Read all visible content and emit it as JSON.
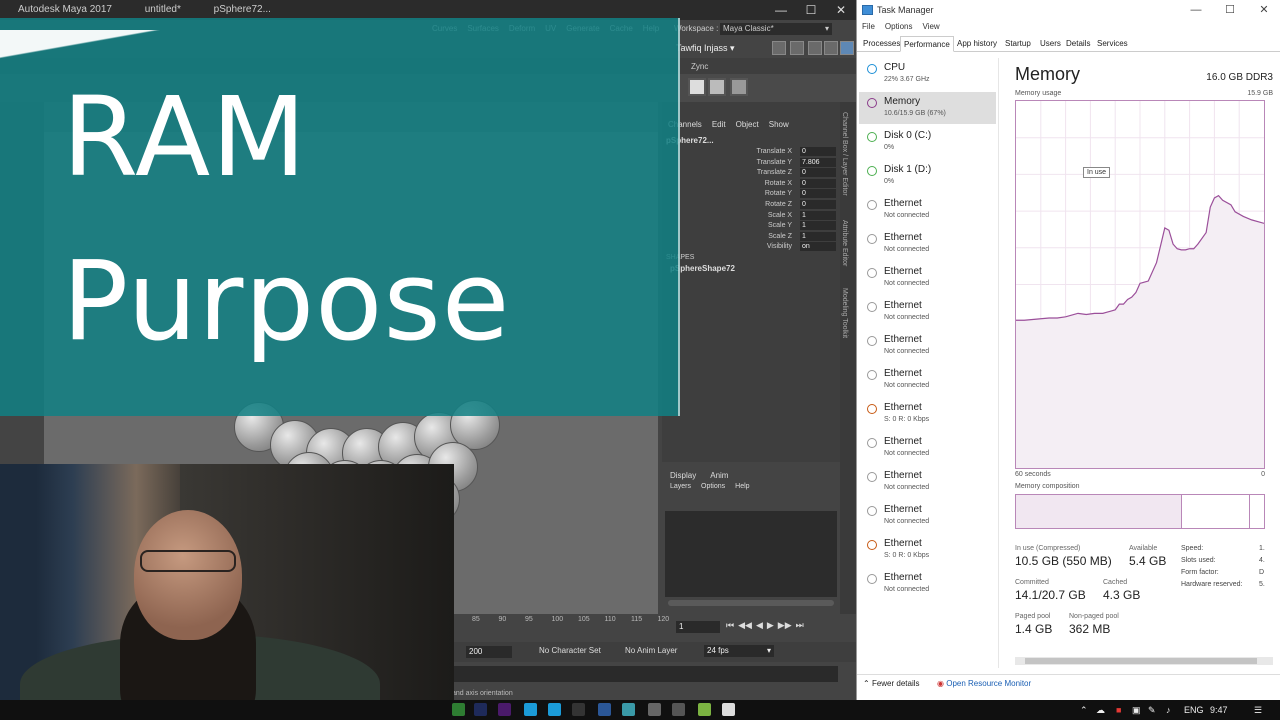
{
  "maya": {
    "title_app": "Autodesk Maya 2017",
    "title_file": "untitled*",
    "title_object": "pSphere72...",
    "menus": [
      "Curves",
      "Surfaces",
      "Deform",
      "UV",
      "Generate",
      "Cache",
      "Help"
    ],
    "workspace_label": "Workspace :",
    "workspace_value": "Maya Classic*",
    "user_name": "Tawfiq Injass",
    "zync_label": "Zync",
    "channel_menu": [
      "Channels",
      "Edit",
      "Object",
      "Show"
    ],
    "object_name": "pSphere72...",
    "attributes": [
      {
        "name": "Translate X",
        "value": "0"
      },
      {
        "name": "Translate Y",
        "value": "7.806"
      },
      {
        "name": "Translate Z",
        "value": "0"
      },
      {
        "name": "Rotate X",
        "value": "0"
      },
      {
        "name": "Rotate Y",
        "value": "0"
      },
      {
        "name": "Rotate Z",
        "value": "0"
      },
      {
        "name": "Scale X",
        "value": "1"
      },
      {
        "name": "Scale Y",
        "value": "1"
      },
      {
        "name": "Scale Z",
        "value": "1"
      },
      {
        "name": "Visibility",
        "value": "on"
      }
    ],
    "shapes_label": "SHAPES",
    "shape_name": "pSphereShape72",
    "side_tabs": [
      "Channel Box / Layer Editor",
      "Attribute Editor",
      "Modeling Toolkit"
    ],
    "layer_tabs": [
      "Display",
      "Anim"
    ],
    "layer_menu": [
      "Layers",
      "Options",
      "Help"
    ],
    "timeline_ticks": [
      "85",
      "90",
      "95",
      "100",
      "105",
      "110",
      "115",
      "120"
    ],
    "current_frame": "1",
    "playback_icons": [
      "⏮",
      "◀◀",
      "◀",
      "▶",
      "▶▶",
      "⏭"
    ],
    "range_end": "200",
    "character_set": "No Character Set",
    "anim_layer": "No Anim Layer",
    "fps": "24 fps",
    "help_line": "and axis orientation"
  },
  "overlay": {
    "line1": "RAM",
    "line2": "Purpose"
  },
  "taskmgr": {
    "title": "Task Manager",
    "menu": [
      "File",
      "Options",
      "View"
    ],
    "tabs": [
      "Processes",
      "Performance",
      "App history",
      "Startup",
      "Users",
      "Details",
      "Services"
    ],
    "sidebar": [
      {
        "name": "CPU",
        "sub": "22%  3.67 GHz",
        "color": "#1c8fd6"
      },
      {
        "name": "Memory",
        "sub": "10.6/15.9 GB (67%)",
        "color": "#8b3c8b"
      },
      {
        "name": "Disk 0 (C:)",
        "sub": "0%",
        "color": "#4caf50"
      },
      {
        "name": "Disk 1 (D:)",
        "sub": "0%",
        "color": "#4caf50"
      },
      {
        "name": "Ethernet",
        "sub": "Not connected",
        "color": "#999999"
      },
      {
        "name": "Ethernet",
        "sub": "Not connected",
        "color": "#999999"
      },
      {
        "name": "Ethernet",
        "sub": "Not connected",
        "color": "#999999"
      },
      {
        "name": "Ethernet",
        "sub": "Not connected",
        "color": "#999999"
      },
      {
        "name": "Ethernet",
        "sub": "Not connected",
        "color": "#999999"
      },
      {
        "name": "Ethernet",
        "sub": "Not connected",
        "color": "#999999"
      },
      {
        "name": "Ethernet",
        "sub": "S: 0 R: 0 Kbps",
        "color": "#c75a14"
      },
      {
        "name": "Ethernet",
        "sub": "Not connected",
        "color": "#999999"
      },
      {
        "name": "Ethernet",
        "sub": "Not connected",
        "color": "#999999"
      },
      {
        "name": "Ethernet",
        "sub": "Not connected",
        "color": "#999999"
      },
      {
        "name": "Ethernet",
        "sub": "S: 0 R: 0 Kbps",
        "color": "#c75a14"
      },
      {
        "name": "Ethernet",
        "sub": "Not connected",
        "color": "#999999"
      }
    ],
    "memory": {
      "title": "Memory",
      "total": "16.0 GB DDR3",
      "usage_label": "Memory usage",
      "max_label": "15.9 GB",
      "tooltip": "In use",
      "seconds_label": "60 seconds",
      "zero_label": "0",
      "composition_label": "Memory composition",
      "composition": {
        "in_use_fraction": 0.67,
        "modified_fraction": 0.012,
        "standby_fraction": 0.26
      },
      "stats": {
        "in_use_label": "In use (Compressed)",
        "in_use": "10.5 GB (550 MB)",
        "available_label": "Available",
        "available": "5.4 GB",
        "committed_label": "Committed",
        "committed": "14.1/20.7 GB",
        "cached_label": "Cached",
        "cached": "4.3 GB",
        "paged_label": "Paged pool",
        "paged": "1.4 GB",
        "nonpaged_label": "Non-paged pool",
        "nonpaged": "362 MB"
      },
      "right_stats": [
        {
          "label": "Speed:",
          "value": "1."
        },
        {
          "label": "Slots used:",
          "value": "4."
        },
        {
          "label": "Form factor:",
          "value": "D"
        },
        {
          "label": "Hardware reserved:",
          "value": "5."
        }
      ]
    },
    "footer": {
      "fewer": "Fewer details",
      "monitor": "Open Resource Monitor"
    }
  },
  "chart_data": {
    "type": "line",
    "xlabel": "60 seconds",
    "ylim": [
      0,
      15.9
    ],
    "x": [
      60,
      58,
      55,
      52,
      50,
      48,
      45,
      43,
      41,
      39,
      38,
      37,
      36,
      35,
      34,
      33,
      32,
      31,
      30,
      28,
      26,
      24,
      23,
      22,
      21,
      20,
      19,
      18,
      17,
      16,
      14,
      13,
      12,
      11,
      10,
      8,
      7,
      5,
      3,
      1,
      0
    ],
    "series": [
      {
        "values": [
          6.4,
          6.4,
          6.45,
          6.5,
          6.5,
          6.55,
          6.7,
          6.65,
          6.7,
          6.7,
          6.75,
          6.8,
          6.85,
          7.1,
          7.1,
          7.3,
          7.4,
          7.6,
          8.0,
          8.1,
          8.9,
          10.4,
          10.3,
          9.7,
          9.5,
          9.45,
          9.45,
          9.5,
          9.5,
          9.7,
          10.2,
          11.3,
          11.7,
          11.8,
          11.6,
          11.4,
          11.1,
          10.9,
          10.75,
          10.65,
          10.6
        ]
      }
    ]
  },
  "taskbar": {
    "lang": "ENG",
    "time": "9:47 PM"
  }
}
